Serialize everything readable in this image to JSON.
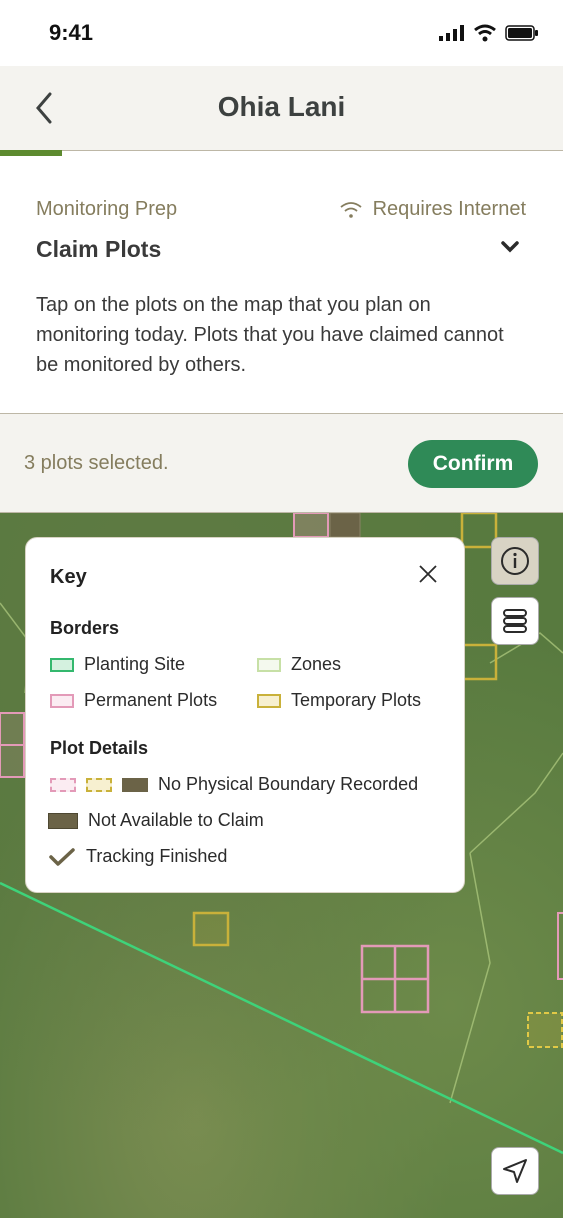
{
  "status": {
    "time": "9:41"
  },
  "header": {
    "title": "Ohia Lani"
  },
  "prep": {
    "step": "Monitoring Prep",
    "requires": "Requires Internet",
    "task": "Claim Plots",
    "description": "Tap on the plots on the map that you plan on monitoring today. Plots that you have claimed cannot be monitored by others."
  },
  "selection": {
    "count_text": "3 plots selected.",
    "confirm_label": "Confirm"
  },
  "key": {
    "title": "Key",
    "borders_heading": "Borders",
    "borders": {
      "planting_site": "Planting Site",
      "zones": "Zones",
      "permanent": "Permanent Plots",
      "temporary": "Temporary Plots"
    },
    "details_heading": "Plot Details",
    "details": {
      "no_boundary": "No Physical Boundary Recorded",
      "not_available": "Not Available to Claim",
      "tracking": "Tracking Finished"
    }
  },
  "colors": {
    "accent_green": "#2f8a57",
    "progress_green": "#5d8a2f",
    "muted_text": "#857d5e",
    "planting_site": "#34b86e",
    "zones": "#c7e0a6",
    "permanent": "#e39ab8",
    "temporary": "#c9b13a"
  },
  "icons": {
    "back": "chevron-left-icon",
    "wifi": "wifi-icon",
    "expand": "chevron-down-icon",
    "info": "info-icon",
    "layers": "layers-icon",
    "navigate": "navigate-arrow-icon",
    "close": "close-icon",
    "check": "check-icon"
  }
}
